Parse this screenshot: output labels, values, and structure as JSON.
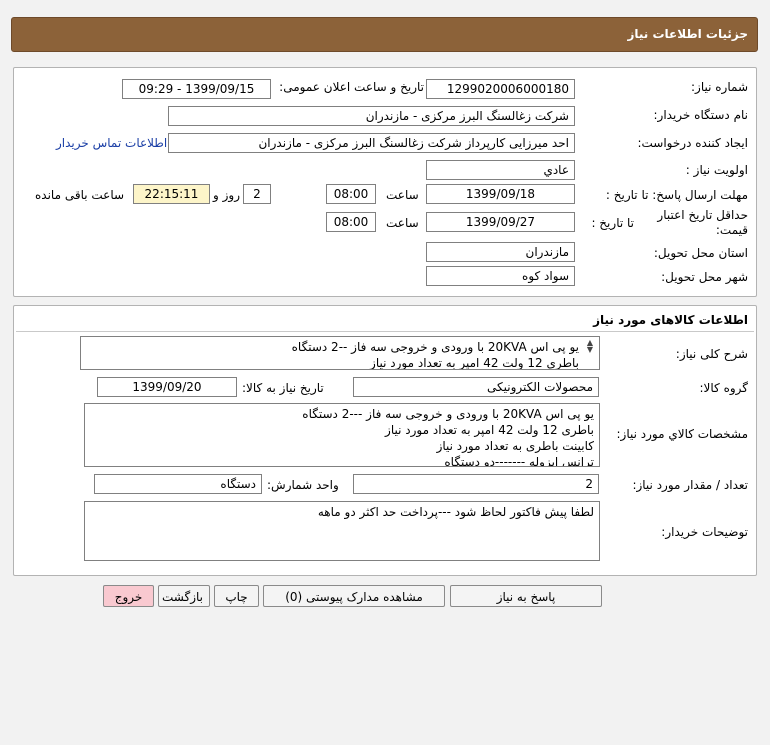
{
  "header": {
    "title": "جزئیات اطلاعات نیاز"
  },
  "details": {
    "need_number_label": "شماره نیاز:",
    "need_number": "1299020006000180",
    "announce_label": "تاریخ و ساعت اعلان عمومی:",
    "announce_value": "1399/09/15 - 09:29",
    "buyer_label": "نام دستگاه خریدار:",
    "buyer_value": "شرکت زغالسنگ البرز مرکزی - مازندران",
    "creator_label": "ایجاد کننده درخواست:",
    "creator_value": "احد میرزایی کارپرداز شرکت زغالسنگ البرز مرکزی - مازندران",
    "contact_link": "اطلاعات تماس خریدار",
    "priority_label": "اولویت نیاز :",
    "priority_value": "عادي",
    "deadline_label": "مهلت ارسال پاسخ: تا تاریخ :",
    "deadline_date": "1399/09/18",
    "time_label": "ساعت",
    "deadline_time": "08:00",
    "days_value": "2",
    "days_label": "روز و",
    "remaining_value": "22:15:11",
    "remaining_label": "ساعت باقی مانده",
    "validity_label": "حداقل تاریخ اعتبار قیمت:",
    "validity_to_label": "تا تاریخ :",
    "validity_date": "1399/09/27",
    "validity_time_label": "ساعت",
    "validity_time": "08:00",
    "province_label": "استان محل تحویل:",
    "province_value": "مازندران",
    "city_label": "شهر محل تحویل:",
    "city_value": "سواد کوه"
  },
  "goods": {
    "section_title": "اطلاعات کالاهای مورد نیاز",
    "summary_label": "شرح کلی نیاز:",
    "summary_lines": "یو پی اس 20KVA با ورودی و خروجی سه فاز --2 دستگاه\nباطری 12 ولت 42 امپر به تعداد مورد نیاز",
    "group_label": "گروه کالا:",
    "group_value": "محصولات الکترونیکی",
    "need_date_label": "تاریخ نیاز به کالا:",
    "need_date": "1399/09/20",
    "specs_label": "مشخصات کالاي مورد نیاز:",
    "specs_lines": "یو پی اس 20KVA با ورودی و خروجی سه فاز ---2 دستگاه\nباطری 12 ولت 42 امپر به تعداد مورد نیاز\nکابینت باطری به تعداد مورد نیاز\nترانس ایزوله -------دو دستگاه",
    "qty_label": "تعداد / مقدار مورد نیاز:",
    "qty_value": "2",
    "unit_label": "واحد شمارش:",
    "unit_value": "دستگاه",
    "notes_label": "توضیحات خریدار:",
    "notes_value": "لطفا پیش فاکتور لحاظ شود ---پرداخت حد اکثر دو ماهه"
  },
  "buttons": {
    "reply": "پاسخ به نیاز",
    "attachments": "مشاهده مدارک پیوستی (0)",
    "print": "چاپ",
    "back": "بازگشت",
    "exit": "خروج"
  }
}
